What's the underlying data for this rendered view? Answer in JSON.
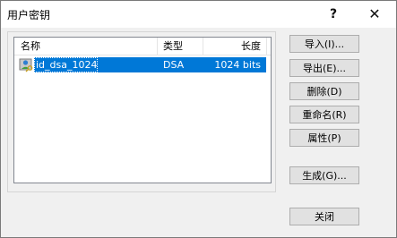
{
  "window": {
    "title": "用户密钥",
    "help_glyph": "?",
    "close_glyph": "✕"
  },
  "keys_table": {
    "columns": [
      "名称",
      "类型",
      "长度"
    ],
    "rows": [
      {
        "name": "id_dsa_1024",
        "type": "DSA",
        "length": "1024 bits",
        "selected": true
      }
    ]
  },
  "buttons": {
    "import": "导入(I)...",
    "export": "导出(E)...",
    "delete": "删除(D)",
    "rename": "重命名(R)",
    "properties": "属性(P)",
    "generate": "生成(G)...",
    "close": "关闭"
  },
  "colors": {
    "selection": "#0078d7",
    "dialog_bg": "#f0f0f0",
    "button_bg": "#e1e1e1"
  },
  "icons": {
    "row_icon": "key-user-icon"
  }
}
